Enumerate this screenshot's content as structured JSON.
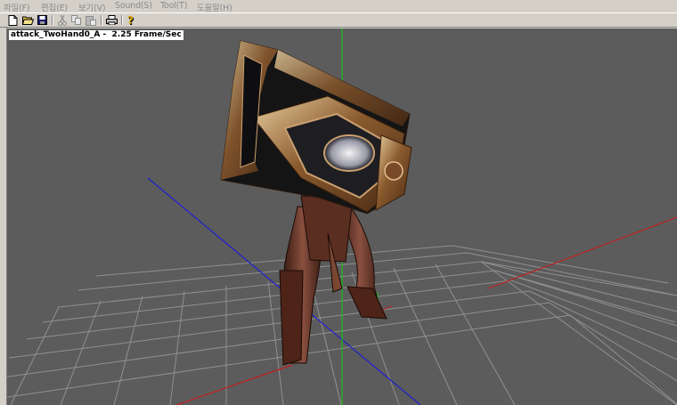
{
  "menu": {
    "items": [
      "파일(F)",
      "편집(E)",
      "보기(V)",
      "Sound(S)",
      "Tool(T)",
      "도움말(H)"
    ]
  },
  "toolbar": {
    "buttons": [
      "new-file",
      "open-folder",
      "save",
      "cut",
      "copy",
      "paste",
      "print",
      "help"
    ]
  },
  "viewport": {
    "caption": "attack_TwoHand0_A -  2.25 Frame/Sec"
  },
  "colors": {
    "viewport_bg": "#5c5c5c",
    "grid": "#9a9a9a",
    "axis_x": "#c02020",
    "axis_y": "#18c018",
    "axis_z": "#2020d0"
  }
}
